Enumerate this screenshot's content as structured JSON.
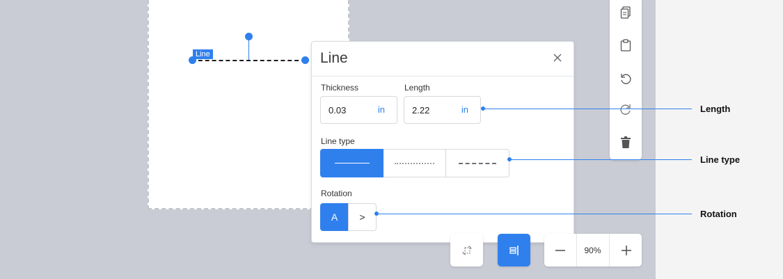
{
  "canvas": {
    "element_tag": "Line"
  },
  "side_toolbar": {
    "items": [
      {
        "name": "copy",
        "icon": "copy-icon"
      },
      {
        "name": "paste",
        "icon": "clipboard-icon"
      },
      {
        "name": "undo",
        "icon": "undo-icon"
      },
      {
        "name": "redo",
        "icon": "redo-icon"
      },
      {
        "name": "delete",
        "icon": "trash-icon"
      }
    ]
  },
  "panel": {
    "title": "Line",
    "close_icon": "close-icon",
    "thickness": {
      "label": "Thickness",
      "value": "0.03",
      "unit": "in"
    },
    "length": {
      "label": "Length",
      "value": "2.22",
      "unit": "in"
    },
    "line_type": {
      "label": "Line type",
      "options": [
        "solid",
        "dotted",
        "dashed"
      ],
      "selected": "solid"
    },
    "rotation": {
      "label": "Rotation",
      "options": [
        {
          "name": "horizontal",
          "glyph": "A"
        },
        {
          "name": "vertical",
          "glyph": ">"
        }
      ],
      "selected": "horizontal"
    }
  },
  "callouts": {
    "length": "Length",
    "line_type": "Line type",
    "rotation": "Rotation"
  },
  "bottom_bar": {
    "rotate_icon": "rotate-canvas-icon",
    "align_icon": "align-right-icon",
    "zoom": {
      "minus_icon": "minus-icon",
      "value": "90%",
      "plus_icon": "plus-icon"
    }
  },
  "colors": {
    "accent": "#2f80ed",
    "workspace": "#c9ccd4",
    "side_area": "#f4f4f5"
  }
}
